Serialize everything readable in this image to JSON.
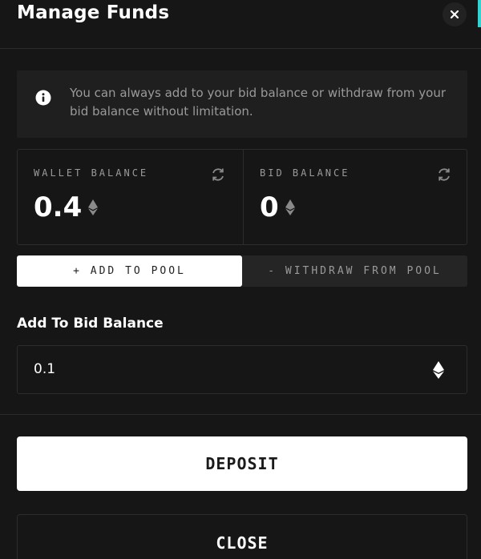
{
  "header": {
    "title": "Manage Funds",
    "close_icon": "close-icon"
  },
  "info": {
    "icon": "info-icon",
    "text": "You can always add to your bid balance or withdraw from your bid balance without limitation."
  },
  "balances": {
    "wallet": {
      "label": "WALLET BALANCE",
      "value": "0.4",
      "currency_icon": "eth-icon",
      "refresh_icon": "refresh-icon"
    },
    "bid": {
      "label": "BID BALANCE",
      "value": "0",
      "currency_icon": "eth-icon",
      "refresh_icon": "refresh-icon"
    }
  },
  "tabs": [
    {
      "label": "+ ADD TO POOL",
      "active": true
    },
    {
      "label": "- WITHDRAW FROM POOL",
      "active": false
    }
  ],
  "form": {
    "label": "Add To Bid Balance",
    "amount_value": "0.1",
    "currency_icon": "eth-icon"
  },
  "buttons": {
    "deposit": "DEPOSIT",
    "close": "CLOSE"
  },
  "colors": {
    "background": "#161616",
    "panel": "#1f1f1f",
    "accent": "#2fd3d0",
    "muted_text": "#9a9a9a"
  }
}
